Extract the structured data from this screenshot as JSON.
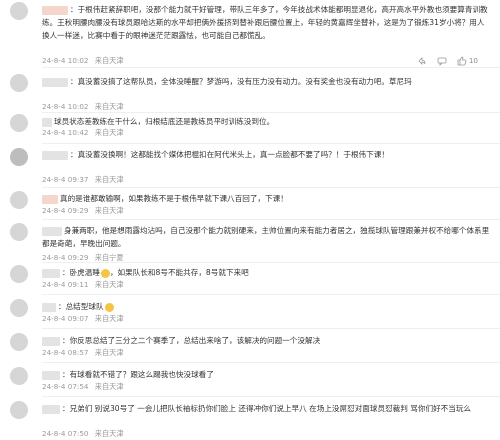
{
  "comments": [
    {
      "text": "：于根伟赶紧辞职吧，没那个能力就干好管理，带队三年多了，今年技战术体能都明显退化，高开高水平外教也须要算青训教练。王秋明腰肉腰没有球员跟哈达斯的水平却把俩外援挤到替补跟后腰位置上，年轻的黄嘉辉坐替补，这是为了锻炼31岁小将？用人换人一样迷，比赛中看于的眼神迷茫茫跟露怯，也可能自己都慌乱。",
      "time": "24-8-4 10:02",
      "location": "来自天津",
      "likes": "10"
    },
    {
      "text": "：真没蓄没搞了这帮队员，全体没睡醒？梦游吗，没有压力没有动力。没有奖金也没有动力吧。草尼玛",
      "time": "24-8-4 10:02",
      "location": "来自天津",
      "likes": ""
    },
    {
      "text": "球员状态差教练在干什么，归根结底还是教练员平时训练没到位。",
      "time": "24-8-4 10:42",
      "location": "来自天津",
      "likes": ""
    },
    {
      "text": "：真没蓄没换啊！这都能找个媒体把棍扣在阿代米头上，真一点脸都不要了吗？！于根伟下课！",
      "time": "24-8-4 09:37",
      "location": "来自天津",
      "likes": ""
    },
    {
      "text": "真的是谁都敢输啊，如果教练不是于根伟早就下课八百回了，下课！",
      "time": "24-8-4 09:29",
      "location": "来自天津",
      "likes": ""
    },
    {
      "text": "身兼两职，他是想雨露均沾吗，自己没那个能力就别硬来，主帅位置向来有能力者居之，独揽球队管理跟兼并权不给哪个体系里都是奇葩，早晚出问题。",
      "time": "24-8-4 09:29",
      "location": "来自宁夏",
      "likes": ""
    },
    {
      "text": "：卧虎温睡",
      "text2": "，如果队长和8号不能共存，8号就下来吧",
      "time": "24-8-4 09:11",
      "location": "来自天津",
      "likes": ""
    },
    {
      "text": "：总结型球队",
      "time": "24-8-4 09:07",
      "location": "来自天津",
      "likes": ""
    },
    {
      "text": "：你反思总结了三分之二个赛季了，总结出来啥了，该解决的问题一个没解决",
      "time": "24-8-4 08:57",
      "location": "来自天津",
      "likes": ""
    },
    {
      "text": "：有球看就不错了？跟这么踢我也快没球看了",
      "time": "24-8-4 07:54",
      "location": "来自天津",
      "likes": ""
    },
    {
      "text": "：兄弟们 别说30号了 一会儿把队长袖标扔你们脸上 还得冲你们说上早八 在场上没屌怼对面球员怼裁判 骂你们好不当玩么",
      "time": "24-8-4 07:50",
      "location": "来自天津",
      "likes": ""
    }
  ]
}
